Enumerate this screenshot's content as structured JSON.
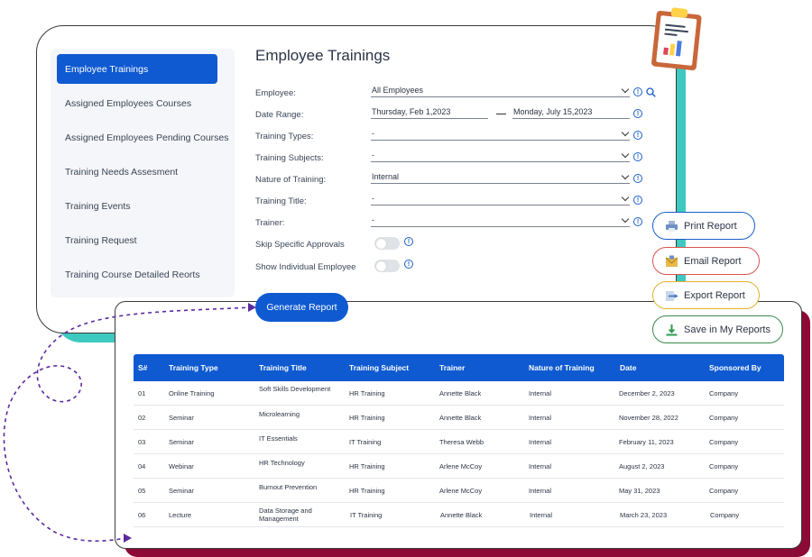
{
  "colors": {
    "primary": "#0f5ad1",
    "teal": "#3ec9c0",
    "maroon": "#8c0a35",
    "dashed_line": "#5b2aa0"
  },
  "sidebar": {
    "items": [
      {
        "label": "Employee Trainings",
        "active": true
      },
      {
        "label": "Assigned Employees Courses",
        "active": false
      },
      {
        "label": "Assigned Employees Pending Courses",
        "active": false
      },
      {
        "label": "Training Needs Assesment",
        "active": false
      },
      {
        "label": "Training Events",
        "active": false
      },
      {
        "label": "Training Request",
        "active": false
      },
      {
        "label": "Training Course Detailed Reorts",
        "active": false
      }
    ]
  },
  "form": {
    "title": "Employee Trainings",
    "employee_label": "Employee:",
    "employee_value": "All Employees",
    "date_range_label": "Date Range:",
    "date_from": "Thursday, Feb 1,2023",
    "date_to": "Monday, July 15,2023",
    "training_types_label": "Training Types:",
    "training_types_value": "-",
    "training_subjects_label": "Training Subjects:",
    "training_subjects_value": "-",
    "nature_label": "Nature of Training:",
    "nature_value": "Internal",
    "title_label": "Training Title:",
    "title_value": "-",
    "trainer_label": "Trainer:",
    "trainer_value": "-",
    "skip_label": "Skip Specific Approvals",
    "skip_on": false,
    "show_individual_label": "Show Individual Employee",
    "show_individual_on": false,
    "generate_label": "Generate Report",
    "info_glyph": "!"
  },
  "report_buttons": {
    "print": {
      "label": "Print Report",
      "border": "#1a5fc9",
      "icon": "printer-icon"
    },
    "email": {
      "label": "Email Report",
      "border": "#d9534f",
      "icon": "envelope-icon"
    },
    "export": {
      "label": "Export Report",
      "border": "#e0b030",
      "icon": "export-icon"
    },
    "save": {
      "label": "Save in My Reports",
      "border": "#3a8a4a",
      "icon": "download-icon"
    }
  },
  "table": {
    "headers": [
      "S#",
      "Training Type",
      "Training Title",
      "Training Subject",
      "Trainer",
      "Nature of Training",
      "Date",
      "Sponsored By"
    ],
    "rows": [
      [
        "01",
        "Online Training",
        "Soft Skills Development",
        "HR Training",
        "Annette Black",
        "Internal",
        "December 2, 2023",
        "Company"
      ],
      [
        "02",
        "Seminar",
        "Microlearning",
        "HR Training",
        "Annette Black",
        "Internal",
        "November 28, 2022",
        "Company"
      ],
      [
        "03",
        "Seminar",
        "IT Essentials",
        "IT Training",
        "Theresa Webb",
        "Internal",
        "February 11, 2023",
        "Company"
      ],
      [
        "04",
        "Webinar",
        "HR Technology",
        "HR Training",
        "Arlene McCoy",
        "Internal",
        "August 2, 2023",
        "Company"
      ],
      [
        "05",
        "Seminar",
        "Burnout Prevention",
        "HR Training",
        "Arlene McCoy",
        "Internal",
        "May 31, 2023",
        "Company"
      ],
      [
        "06",
        "Lecture",
        "Data Storage and Management",
        "IT Training",
        "Annette Black",
        "Internal",
        "March 23, 2023",
        "Company"
      ]
    ]
  }
}
